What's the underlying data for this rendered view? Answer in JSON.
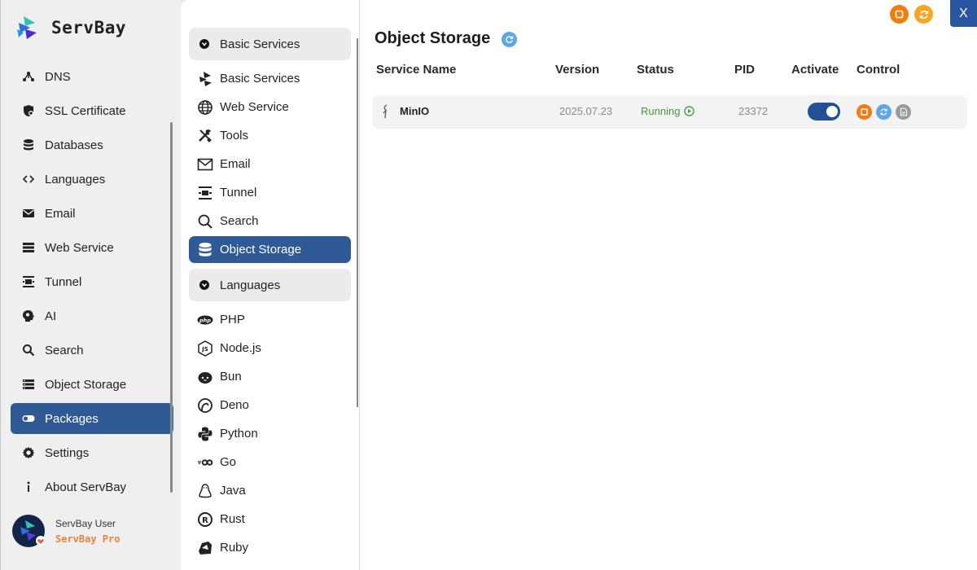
{
  "app": {
    "brand": "ServBay"
  },
  "sidebar": {
    "items": [
      {
        "label": "DNS",
        "icon": "network-icon"
      },
      {
        "label": "SSL Certificate",
        "icon": "certificate-icon"
      },
      {
        "label": "Databases",
        "icon": "database-icon"
      },
      {
        "label": "Languages",
        "icon": "code-icon"
      },
      {
        "label": "Email",
        "icon": "mail-icon"
      },
      {
        "label": "Web Service",
        "icon": "server-icon"
      },
      {
        "label": "Tunnel",
        "icon": "tunnel-icon"
      },
      {
        "label": "AI",
        "icon": "brain-icon"
      },
      {
        "label": "Search",
        "icon": "search-icon"
      },
      {
        "label": "Object Storage",
        "icon": "storage-icon"
      },
      {
        "label": "Packages",
        "icon": "toggle-icon",
        "active": true
      },
      {
        "label": "Settings",
        "icon": "gear-icon"
      },
      {
        "label": "About ServBay",
        "icon": "info-icon"
      }
    ],
    "user": {
      "name": "ServBay User",
      "plan": "ServBay Pro"
    }
  },
  "nav": {
    "groups": {
      "basic": "Basic Services",
      "languages": "Languages"
    },
    "basic_items": [
      {
        "label": "Basic Services",
        "icon": "servbay-logo-icon"
      },
      {
        "label": "Web Service",
        "icon": "globe-icon"
      },
      {
        "label": "Tools",
        "icon": "tools-icon"
      },
      {
        "label": "Email",
        "icon": "mail-icon"
      },
      {
        "label": "Tunnel",
        "icon": "tunnel-icon"
      },
      {
        "label": "Search",
        "icon": "search-icon"
      },
      {
        "label": "Object Storage",
        "icon": "database-icon",
        "active": true
      }
    ],
    "language_items": [
      {
        "label": "PHP",
        "icon": "php-icon"
      },
      {
        "label": "Node.js",
        "icon": "nodejs-icon"
      },
      {
        "label": "Bun",
        "icon": "bun-icon"
      },
      {
        "label": "Deno",
        "icon": "deno-icon"
      },
      {
        "label": "Python",
        "icon": "python-icon"
      },
      {
        "label": "Go",
        "icon": "go-icon"
      },
      {
        "label": "Java",
        "icon": "java-icon"
      },
      {
        "label": "Rust",
        "icon": "rust-icon"
      },
      {
        "label": "Ruby",
        "icon": "ruby-icon"
      }
    ]
  },
  "main": {
    "title": "Object Storage",
    "columns": {
      "name": "Service Name",
      "version": "Version",
      "status": "Status",
      "pid": "PID",
      "activate": "Activate",
      "control": "Control"
    },
    "rows": [
      {
        "name": "MinIO",
        "version": "2025.07.23",
        "status": "Running",
        "pid": "23372",
        "activated": true
      }
    ]
  },
  "window": {
    "close_label": "X"
  },
  "colors": {
    "accent": "#2f5a96",
    "running": "#3e9b3e",
    "stop": "#f07d10",
    "refresh": "#5ea6ea",
    "log": "#9a9a9a",
    "plan": "#e8823a"
  }
}
